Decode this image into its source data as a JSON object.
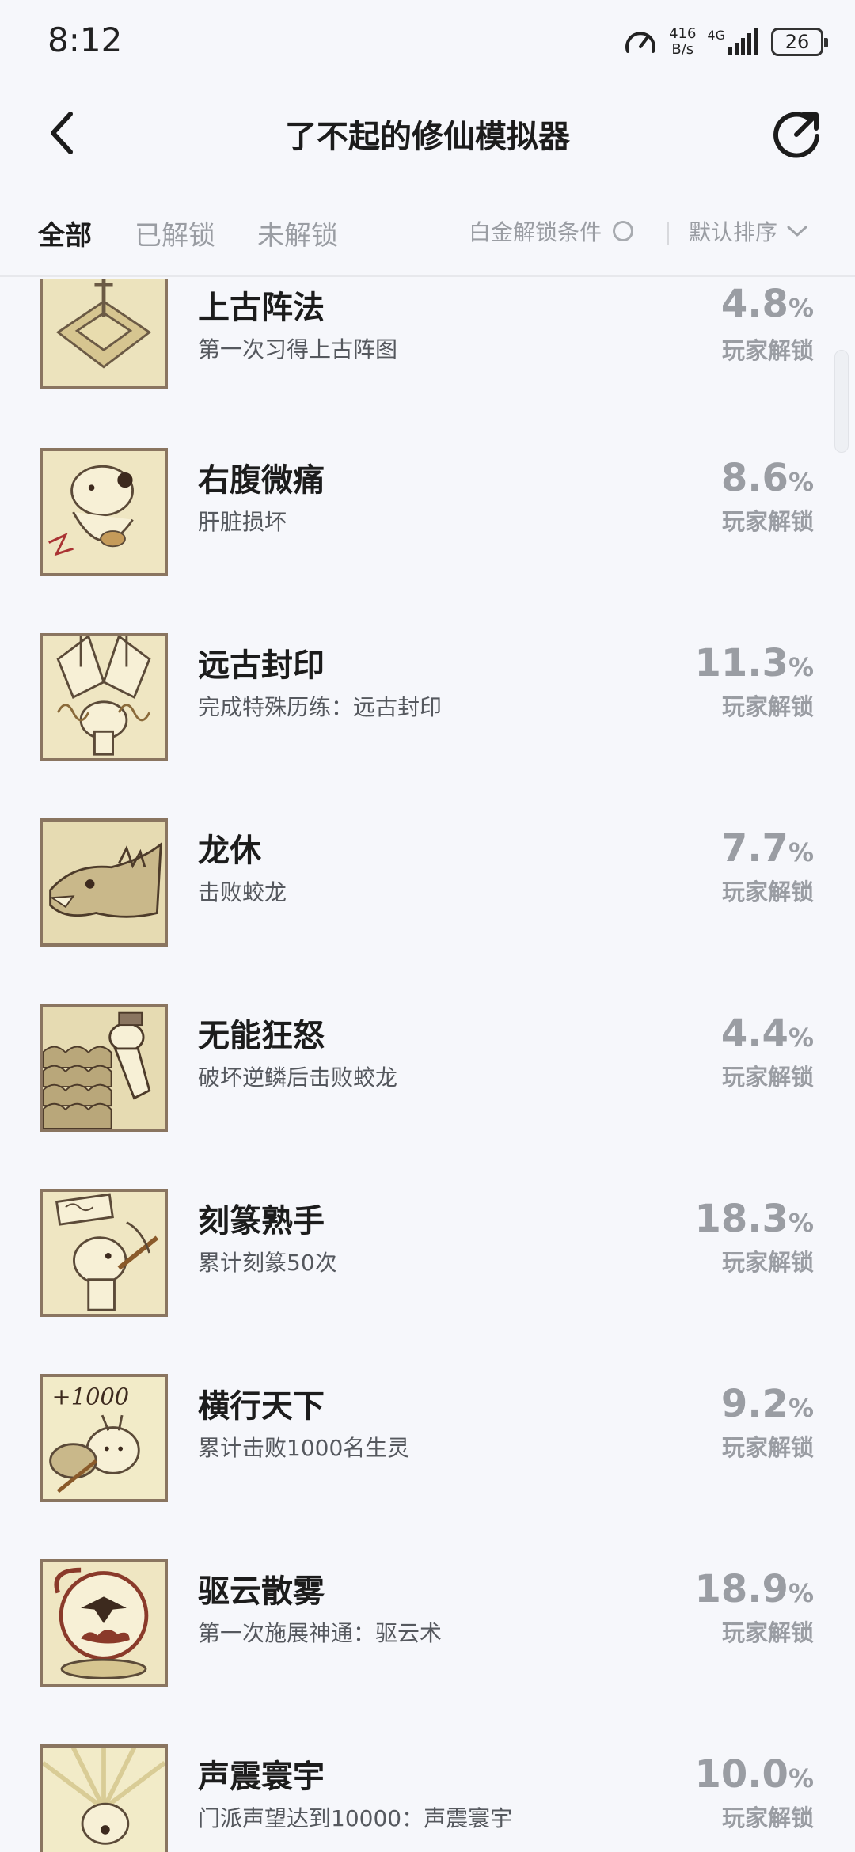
{
  "status": {
    "time": "8:12",
    "net_speed_value": "416",
    "net_speed_unit": "B/s",
    "network_type": "4G",
    "battery": "26"
  },
  "header": {
    "title": "了不起的修仙模拟器"
  },
  "tabs": [
    {
      "label": "全部",
      "active": true
    },
    {
      "label": "已解锁",
      "active": false
    },
    {
      "label": "未解锁",
      "active": false
    }
  ],
  "filter_label": "白金解锁条件",
  "sort_label": "默认排序",
  "unlock_label": "玩家解锁",
  "percent_unit": "%",
  "achievements": [
    {
      "title": "上古阵法",
      "desc": "第一次习得上古阵图",
      "percent": "4.8",
      "icon": "formation-array-icon"
    },
    {
      "title": "右腹微痛",
      "desc": "肝脏损坏",
      "percent": "8.6",
      "icon": "stomach-pain-icon"
    },
    {
      "title": "远古封印",
      "desc": "完成特殊历练：远古封印",
      "percent": "11.3",
      "icon": "ancient-seal-icon"
    },
    {
      "title": "龙休",
      "desc": "击败蛟龙",
      "percent": "7.7",
      "icon": "dragon-head-icon"
    },
    {
      "title": "无能狂怒",
      "desc": "破坏逆鳞后击败蛟龙",
      "percent": "4.4",
      "icon": "dragon-scales-icon"
    },
    {
      "title": "刻篆熟手",
      "desc": "累计刻篆50次",
      "percent": "18.3",
      "icon": "talisman-carver-icon"
    },
    {
      "title": "横行天下",
      "desc": "累计击败1000名生灵",
      "percent": "9.2",
      "icon": "plus-1000-icon"
    },
    {
      "title": "驱云散雾",
      "desc": "第一次施展神通：驱云术",
      "percent": "18.9",
      "icon": "cloud-bird-icon"
    },
    {
      "title": "声震寰宇",
      "desc": "门派声望达到10000：声震寰宇",
      "percent": "10.0",
      "icon": "sound-shout-icon"
    }
  ],
  "colors": {
    "background": "#f6f7fb",
    "badge_bg": "#e9dfb7",
    "badge_border": "#8a7560",
    "muted": "#9a9da3"
  }
}
